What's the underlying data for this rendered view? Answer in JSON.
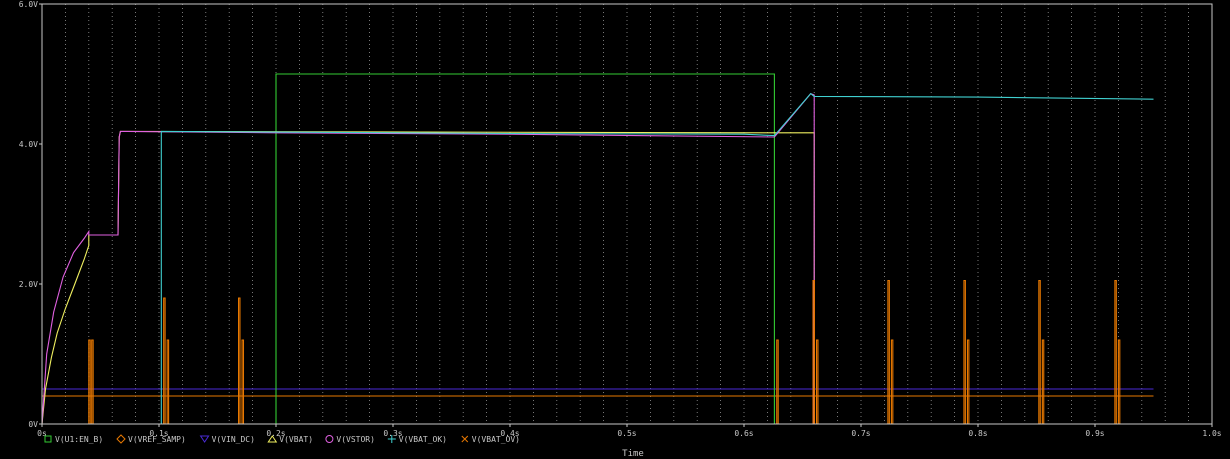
{
  "chart_data": {
    "type": "line",
    "xlabel": "Time",
    "ylabel": "",
    "xlim": [
      0,
      1.0
    ],
    "ylim": [
      0,
      6.0
    ],
    "x_ticks": [
      {
        "value": 0,
        "label": "0s"
      },
      {
        "value": 0.1,
        "label": "0.1s"
      },
      {
        "value": 0.2,
        "label": "0.2s"
      },
      {
        "value": 0.3,
        "label": "0.3s"
      },
      {
        "value": 0.4,
        "label": "0.4s"
      },
      {
        "value": 0.5,
        "label": "0.5s"
      },
      {
        "value": 0.6,
        "label": "0.6s"
      },
      {
        "value": 0.7,
        "label": "0.7s"
      },
      {
        "value": 0.8,
        "label": "0.8s"
      },
      {
        "value": 0.9,
        "label": "0.9s"
      },
      {
        "value": 1.0,
        "label": "1.0s"
      }
    ],
    "y_ticks": [
      {
        "value": 0,
        "label": "0V"
      },
      {
        "value": 2.0,
        "label": "2.0V"
      },
      {
        "value": 4.0,
        "label": "4.0V"
      },
      {
        "value": 6.0,
        "label": "6.0V"
      }
    ],
    "grid": {
      "vertical_dotted_step": 0.02
    },
    "legend_position": "bottom-left",
    "series": [
      {
        "name": "V(U1:EN_B)",
        "marker": "square",
        "color": "#33cc33",
        "points": [
          [
            0,
            0
          ],
          [
            0.2,
            0
          ],
          [
            0.2,
            5.0
          ],
          [
            0.626,
            5.0
          ],
          [
            0.626,
            0
          ],
          [
            0.95,
            0
          ]
        ]
      },
      {
        "name": "V(VREF_SAMP)",
        "marker": "diamond",
        "color": "#e87800",
        "points": [
          [
            0,
            0.4
          ],
          [
            0.95,
            0.4
          ]
        ]
      },
      {
        "name": "V(VIN_DC)",
        "marker": "triangle-down",
        "color": "#4a2ad6",
        "points": [
          [
            0,
            0.5
          ],
          [
            0.95,
            0.5
          ]
        ]
      },
      {
        "name": "V(VBAT)",
        "marker": "triangle-up",
        "color": "#f0f060",
        "points": [
          [
            0,
            0
          ],
          [
            0.003,
            0.5
          ],
          [
            0.008,
            0.95
          ],
          [
            0.013,
            1.3
          ],
          [
            0.02,
            1.65
          ],
          [
            0.028,
            2.0
          ],
          [
            0.036,
            2.35
          ],
          [
            0.04,
            2.55
          ],
          [
            0.04,
            2.7
          ],
          [
            0.065,
            2.7
          ],
          [
            0.066,
            4.1
          ],
          [
            0.067,
            4.18
          ],
          [
            0.62,
            4.16
          ],
          [
            0.66,
            4.16
          ],
          [
            0.66,
            0
          ],
          [
            0.95,
            0
          ]
        ]
      },
      {
        "name": "V(VSTOR)",
        "marker": "circle",
        "color": "#e060e0",
        "points": [
          [
            0,
            0
          ],
          [
            0.004,
            1.0
          ],
          [
            0.01,
            1.6
          ],
          [
            0.018,
            2.1
          ],
          [
            0.027,
            2.45
          ],
          [
            0.036,
            2.65
          ],
          [
            0.04,
            2.75
          ],
          [
            0.04,
            2.7
          ],
          [
            0.065,
            2.7
          ],
          [
            0.066,
            4.1
          ],
          [
            0.067,
            4.18
          ],
          [
            0.2,
            4.16
          ],
          [
            0.4,
            4.14
          ],
          [
            0.626,
            4.1
          ],
          [
            0.657,
            4.72
          ],
          [
            0.66,
            4.7
          ],
          [
            0.66,
            0
          ],
          [
            0.95,
            0
          ]
        ]
      },
      {
        "name": "V(VBAT_OK)",
        "marker": "plus",
        "color": "#40d0d0",
        "points": [
          [
            0,
            0
          ],
          [
            0.102,
            0
          ],
          [
            0.102,
            4.18
          ],
          [
            0.2,
            4.17
          ],
          [
            0.4,
            4.15
          ],
          [
            0.6,
            4.14
          ],
          [
            0.626,
            4.12
          ],
          [
            0.657,
            4.72
          ],
          [
            0.66,
            4.68
          ],
          [
            0.8,
            4.67
          ],
          [
            0.95,
            4.64
          ]
        ]
      },
      {
        "name": "V(VBAT_OV)",
        "marker": "x",
        "color": "#e87800",
        "points": [
          [
            0,
            0
          ],
          [
            0.95,
            0
          ]
        ]
      }
    ],
    "pulse_series": "V(VREF_SAMP)",
    "pulses": [
      {
        "t": 0.04,
        "w": 0.0012,
        "v": 1.2
      },
      {
        "t": 0.0425,
        "w": 0.0012,
        "v": 1.2
      },
      {
        "t": 0.104,
        "w": 0.0012,
        "v": 1.8
      },
      {
        "t": 0.107,
        "w": 0.0012,
        "v": 1.2
      },
      {
        "t": 0.168,
        "w": 0.0012,
        "v": 1.8
      },
      {
        "t": 0.171,
        "w": 0.0012,
        "v": 1.2
      },
      {
        "t": 0.628,
        "w": 0.0012,
        "v": 1.2
      },
      {
        "t": 0.659,
        "w": 0.0012,
        "v": 2.05
      },
      {
        "t": 0.662,
        "w": 0.0012,
        "v": 1.2
      },
      {
        "t": 0.723,
        "w": 0.0012,
        "v": 2.05
      },
      {
        "t": 0.726,
        "w": 0.0012,
        "v": 1.2
      },
      {
        "t": 0.788,
        "w": 0.0012,
        "v": 2.05
      },
      {
        "t": 0.791,
        "w": 0.0012,
        "v": 1.2
      },
      {
        "t": 0.852,
        "w": 0.0012,
        "v": 2.05
      },
      {
        "t": 0.855,
        "w": 0.0012,
        "v": 1.2
      },
      {
        "t": 0.917,
        "w": 0.0012,
        "v": 2.05
      },
      {
        "t": 0.92,
        "w": 0.0012,
        "v": 1.2
      }
    ]
  },
  "colors": {
    "background": "#000000",
    "frame": "#c8c8c8",
    "grid": "#c8c8c8",
    "text": "#c8c8c8"
  }
}
